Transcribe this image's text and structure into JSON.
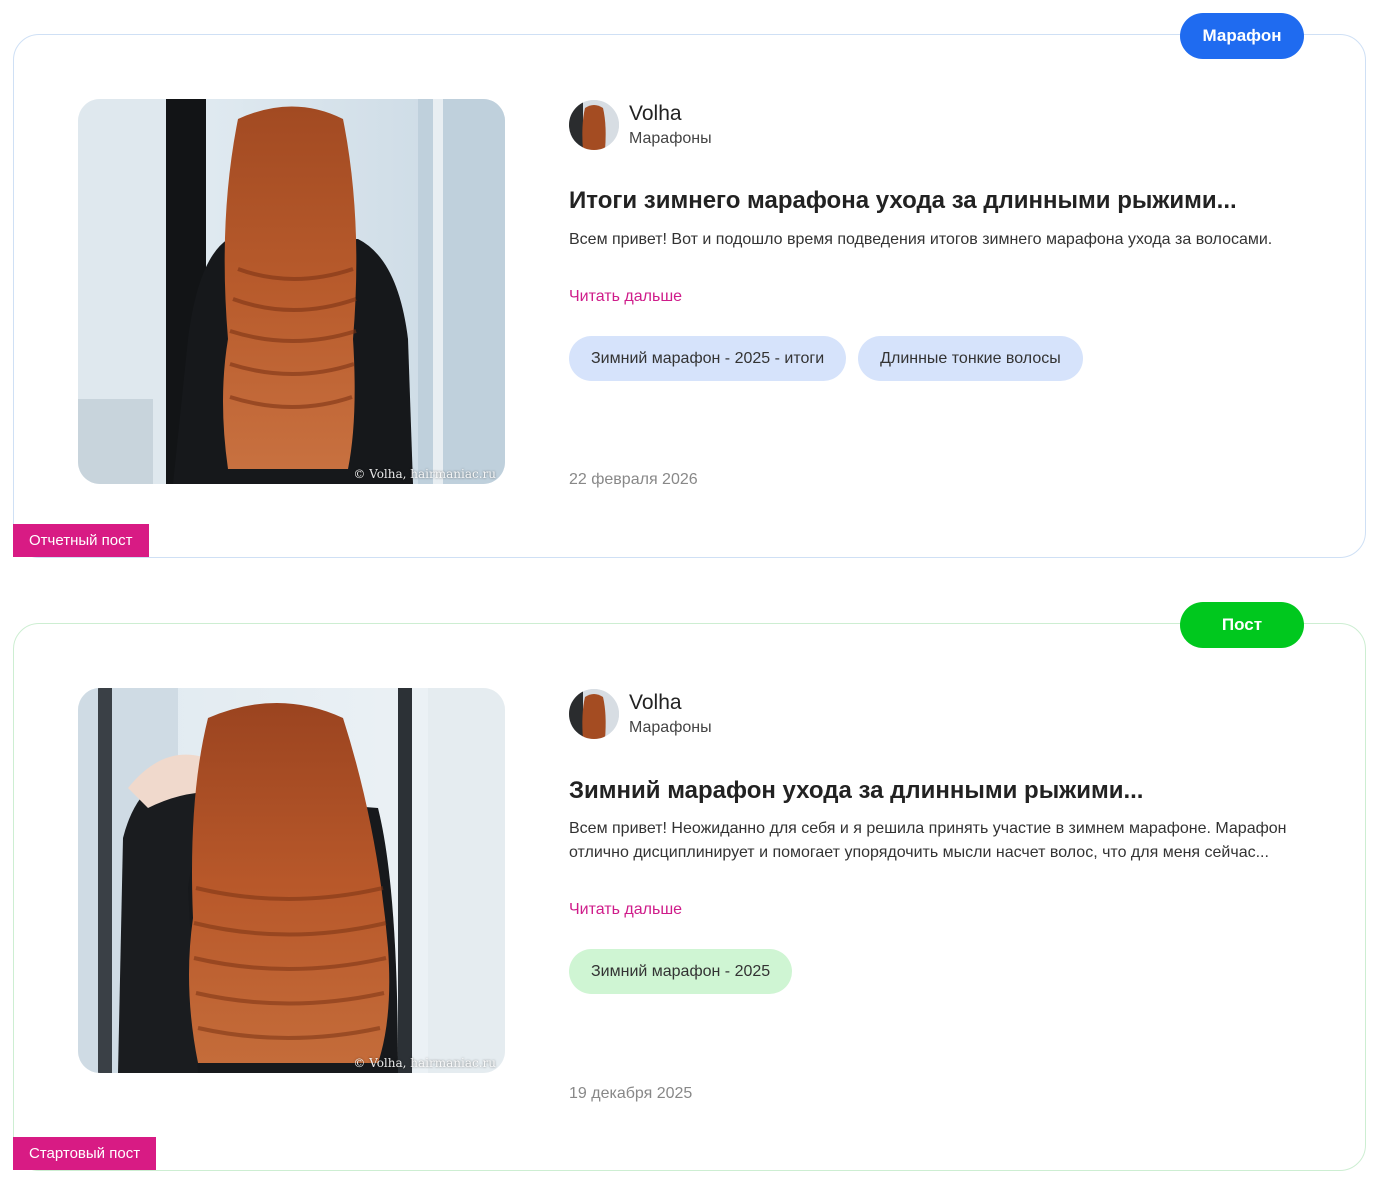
{
  "posts": [
    {
      "type_label": "Марафон",
      "author": {
        "name": "Volha",
        "category": "Марафоны"
      },
      "title": "Итоги зимнего марафона ухода за длинными рыжими...",
      "excerpt": "Всем привет! Вот и подошло время подведения итогов зимнего марафона ухода за волосами.",
      "read_more": "Читать дальше",
      "tags": [
        "Зимний марафон - 2025 - итоги",
        "Длинные тонкие волосы"
      ],
      "date": "22 февраля 2026",
      "badge": "Отчетный пост",
      "watermark": "© Volha, hairmaniac.ru",
      "accent_color": "#1f6bf0"
    },
    {
      "type_label": "Пост",
      "author": {
        "name": "Volha",
        "category": "Марафоны"
      },
      "title": "Зимний марафон ухода за длинными рыжими...",
      "excerpt": "Всем привет! Неожиданно для себя и я решила принять участие в зимнем марафоне. Марафон отлично дисциплинирует и помогает упорядочить мысли насчет волос, что для меня сейчас...",
      "read_more": "Читать дальше",
      "tags": [
        "Зимний марафон - 2025"
      ],
      "date": "19 декабря 2025",
      "badge": "Стартовый пост",
      "watermark": "© Volha, hairmaniac.ru",
      "accent_color": "#00c81e"
    }
  ],
  "colors": {
    "read_more": "#cf1c8a",
    "badge": "#d81b84"
  }
}
